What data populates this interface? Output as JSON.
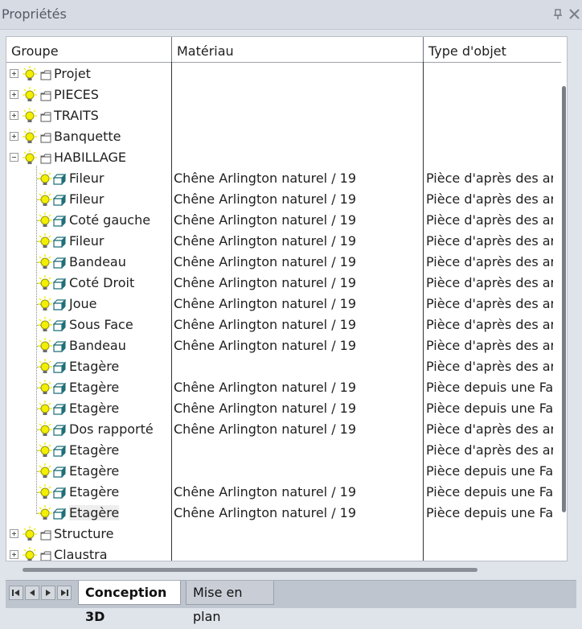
{
  "window": {
    "title": "Propriétés",
    "pin_icon": "pin-icon",
    "close_icon": "close-icon"
  },
  "columns": [
    "Groupe",
    "Matériau",
    "Type d'objet"
  ],
  "rows": [
    {
      "name": "Projet",
      "kind": "group",
      "material": "",
      "type": ""
    },
    {
      "name": "PIECES",
      "kind": "group",
      "material": "",
      "type": ""
    },
    {
      "name": "TRAITS",
      "kind": "group",
      "material": "",
      "type": ""
    },
    {
      "name": "Banquette",
      "kind": "group",
      "material": "",
      "type": ""
    },
    {
      "name": "HABILLAGE",
      "kind": "group-open",
      "material": "",
      "type": ""
    },
    {
      "name": "Fileur",
      "kind": "part",
      "material": "Chêne Arlington naturel / 19",
      "type": "Pièce d'après des arêtes"
    },
    {
      "name": "Fileur",
      "kind": "part",
      "material": "Chêne Arlington naturel / 19",
      "type": "Pièce d'après des arêtes"
    },
    {
      "name": "Coté  gauche",
      "kind": "part",
      "material": "Chêne Arlington naturel / 19",
      "type": "Pièce d'après des arêtes"
    },
    {
      "name": "Fileur",
      "kind": "part",
      "material": "Chêne Arlington naturel / 19",
      "type": "Pièce d'après des arêtes"
    },
    {
      "name": "Bandeau",
      "kind": "part",
      "material": "Chêne Arlington naturel / 19",
      "type": "Pièce d'après des arêtes"
    },
    {
      "name": "Coté  Droit",
      "kind": "part",
      "material": "Chêne Arlington naturel / 19",
      "type": "Pièce d'après des arêtes"
    },
    {
      "name": "Joue",
      "kind": "part",
      "material": "Chêne Arlington naturel / 19",
      "type": "Pièce d'après des arêtes"
    },
    {
      "name": "Sous Face",
      "kind": "part",
      "material": "Chêne Arlington naturel / 19",
      "type": "Pièce d'après des arêtes"
    },
    {
      "name": "Bandeau",
      "kind": "part",
      "material": "Chêne Arlington naturel / 19",
      "type": "Pièce d'après des arêtes"
    },
    {
      "name": "Etagère",
      "kind": "part",
      "material": "",
      "type": "Pièce d'après des arêtes"
    },
    {
      "name": "Etagère",
      "kind": "part",
      "material": "Chêne Arlington naturel / 19",
      "type": "Pièce depuis une Face"
    },
    {
      "name": "Etagère",
      "kind": "part",
      "material": "Chêne Arlington naturel / 19",
      "type": "Pièce depuis une Face"
    },
    {
      "name": "Dos rapporté",
      "kind": "part",
      "material": "Chêne Arlington naturel / 19",
      "type": "Pièce d'après des arêtes"
    },
    {
      "name": "Etagère",
      "kind": "part",
      "material": "",
      "type": "Pièce d'après des arêtes"
    },
    {
      "name": "Etagère",
      "kind": "part",
      "material": "",
      "type": "Pièce depuis une Face"
    },
    {
      "name": "Etagère",
      "kind": "part",
      "material": "Chêne Arlington naturel / 19",
      "type": "Pièce depuis une Face"
    },
    {
      "name": "Etagère",
      "kind": "part-selected",
      "material": "Chêne Arlington naturel / 19",
      "type": "Pièce depuis une Face"
    },
    {
      "name": "Structure",
      "kind": "group",
      "material": "",
      "type": ""
    },
    {
      "name": "Claustra",
      "kind": "group",
      "material": "",
      "type": ""
    }
  ],
  "tabs": [
    {
      "label": "Conception 3D",
      "active": true
    },
    {
      "label": "Mise en plan",
      "active": false
    }
  ],
  "colors": {
    "bulb": "#f2ef00",
    "part_icon": "#1f6f7a",
    "folder": "#5a5a5a"
  }
}
